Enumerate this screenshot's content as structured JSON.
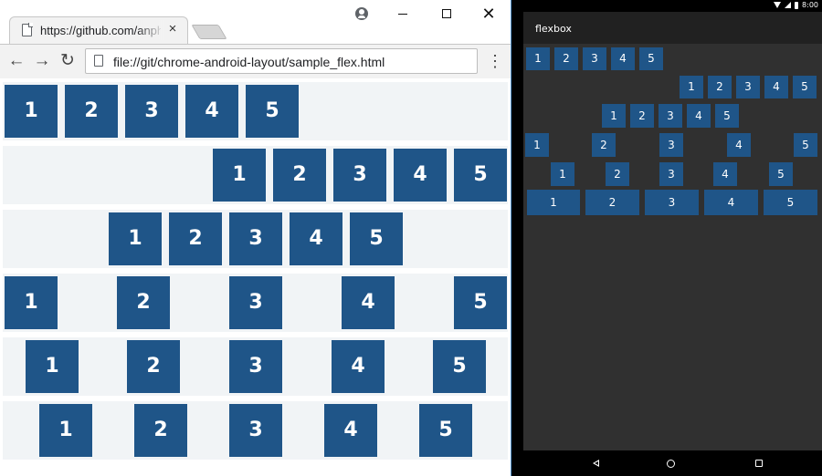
{
  "browser": {
    "tab_title": "https://github.com/anphanorton",
    "tab_close": "×",
    "address": "file://git/chrome-android-layout/sample_flex.html",
    "window_close": "✕",
    "back": "←",
    "forward": "→",
    "reload": "↻",
    "menu": "⋮"
  },
  "rows": [
    [
      "1",
      "2",
      "3",
      "4",
      "5"
    ],
    [
      "1",
      "2",
      "3",
      "4",
      "5"
    ],
    [
      "1",
      "2",
      "3",
      "4",
      "5"
    ],
    [
      "1",
      "2",
      "3",
      "4",
      "5"
    ],
    [
      "1",
      "2",
      "3",
      "4",
      "5"
    ],
    [
      "1",
      "2",
      "3",
      "4",
      "5"
    ]
  ],
  "android": {
    "clock": "8:00",
    "app_title": "flexbox"
  },
  "colors": {
    "box": "#1f5588",
    "row_bg": "#f1f4f6",
    "android_bg": "#303030",
    "android_appbar": "#212121"
  }
}
